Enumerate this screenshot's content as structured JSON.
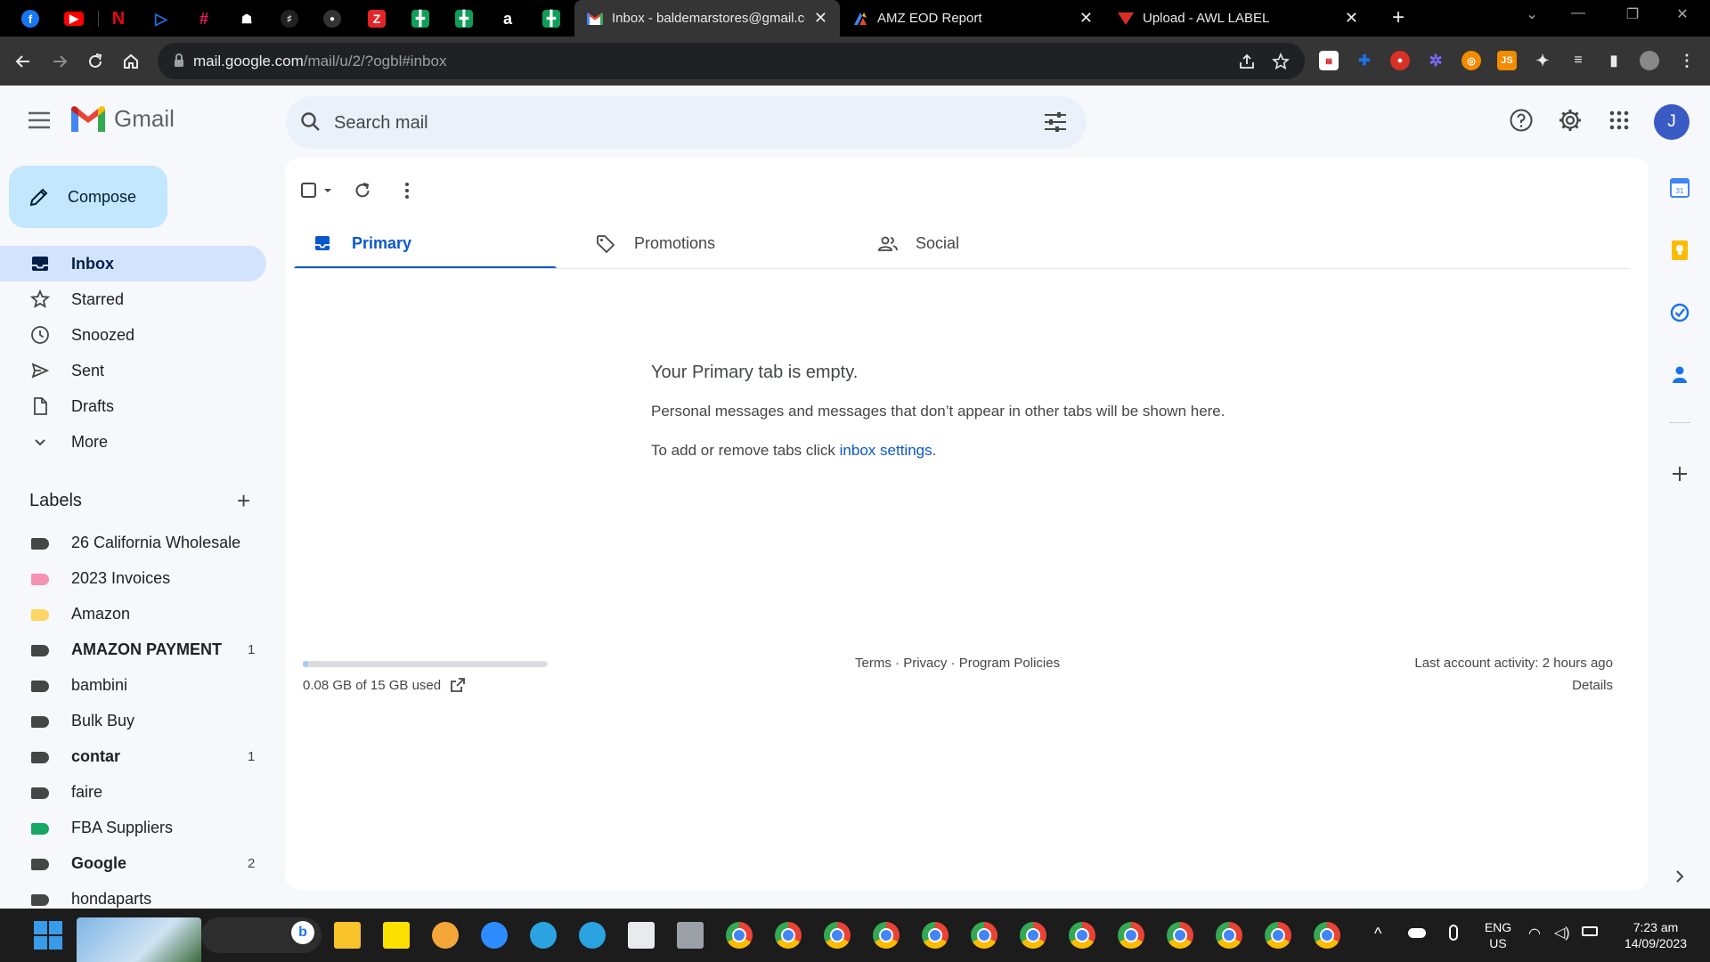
{
  "browser": {
    "tabs": [
      {
        "title": "Inbox - baldemarstores@gmail.com",
        "active": true
      },
      {
        "title": "AMZ EOD Report",
        "active": false
      },
      {
        "title": "Upload - AWL LABEL",
        "active": false
      }
    ],
    "url_host": "mail.google.com",
    "url_path": "/mail/u/2/?ogbl#inbox"
  },
  "gmail": {
    "logo_text": "Gmail",
    "search_placeholder": "Search mail",
    "avatar_initial": "J",
    "compose_label": "Compose",
    "nav": [
      {
        "label": "Inbox",
        "icon": "inbox-icon"
      },
      {
        "label": "Starred",
        "icon": "star-icon"
      },
      {
        "label": "Snoozed",
        "icon": "clock-icon"
      },
      {
        "label": "Sent",
        "icon": "send-icon"
      },
      {
        "label": "Drafts",
        "icon": "draft-icon"
      },
      {
        "label": "More",
        "icon": "chevron-down-icon"
      }
    ],
    "labels_heading": "Labels",
    "labels": [
      {
        "name": "26 California Wholesale",
        "color": "#444746",
        "count": "",
        "bold": false
      },
      {
        "name": "2023 Invoices",
        "color": "#f691b2",
        "count": "",
        "bold": false
      },
      {
        "name": "Amazon",
        "color": "#fdd663",
        "count": "",
        "bold": false
      },
      {
        "name": "AMAZON PAYMENT",
        "color": "#444746",
        "count": "1",
        "bold": true
      },
      {
        "name": "bambini",
        "color": "#444746",
        "count": "",
        "bold": false
      },
      {
        "name": "Bulk Buy",
        "color": "#444746",
        "count": "",
        "bold": false
      },
      {
        "name": "contar",
        "color": "#444746",
        "count": "1",
        "bold": true
      },
      {
        "name": "faire",
        "color": "#444746",
        "count": "",
        "bold": false
      },
      {
        "name": "FBA Suppliers",
        "color": "#16a765",
        "count": "",
        "bold": false
      },
      {
        "name": "Google",
        "color": "#444746",
        "count": "2",
        "bold": true
      },
      {
        "name": "hondaparts",
        "color": "#444746",
        "count": "",
        "bold": false
      }
    ],
    "category_tabs": [
      {
        "label": "Primary",
        "icon": "inbox-tab-icon"
      },
      {
        "label": "Promotions",
        "icon": "tag-icon"
      },
      {
        "label": "Social",
        "icon": "people-icon"
      }
    ],
    "empty": {
      "title": "Your Primary tab is empty.",
      "description": "Personal messages and messages that don’t appear in other tabs will be shown here.",
      "settings_prefix": "To add or remove tabs click ",
      "settings_link": "inbox settings",
      "settings_suffix": "."
    },
    "footer": {
      "storage_text": "0.08 GB of 15 GB used",
      "storage_fraction": 0.0053,
      "terms": "Terms",
      "privacy": "Privacy",
      "policies": "Program Policies",
      "separator": " · ",
      "activity": "Last account activity: 2 hours ago",
      "details": "Details"
    }
  },
  "taskbar": {
    "lang": "ENG",
    "region": "US",
    "time": "7:23 am",
    "date": "14/09/2023"
  }
}
